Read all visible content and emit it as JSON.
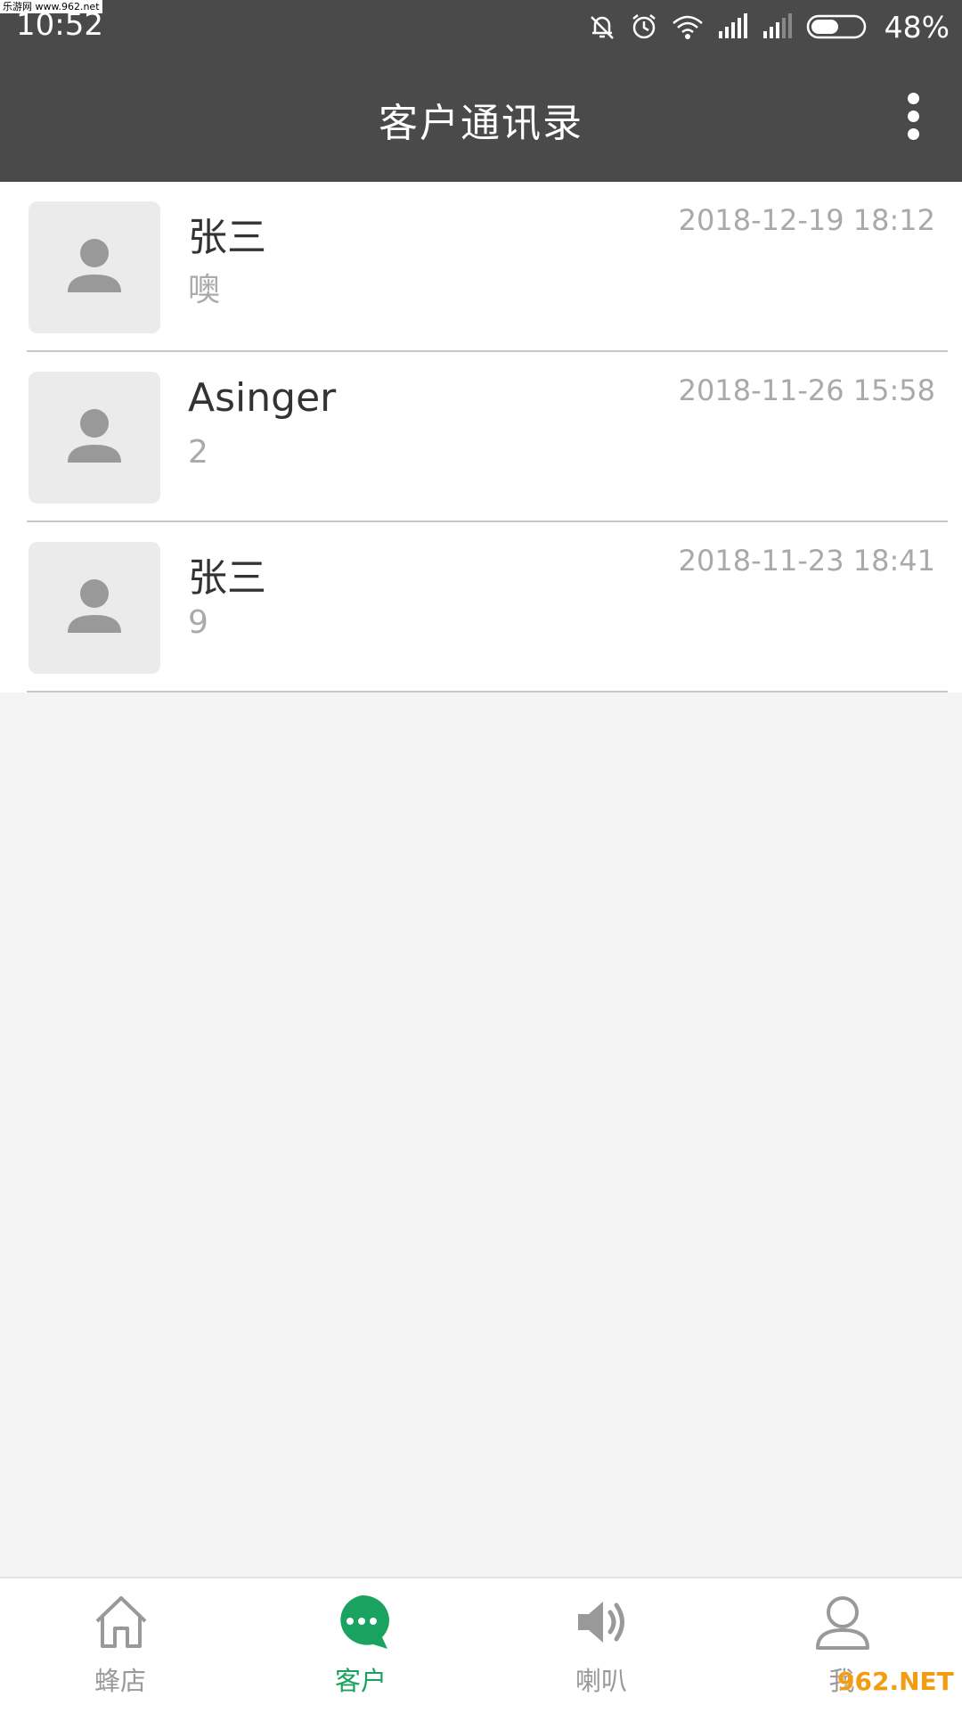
{
  "status_bar": {
    "time": "10:52",
    "watermark": "乐游网 www.962.net",
    "battery_percent": "48%"
  },
  "header": {
    "title": "客户通讯录",
    "menu_icon": "more-vertical-icon"
  },
  "contacts": [
    {
      "name": "张三",
      "last_message": "噢",
      "timestamp": "2018-12-19 18:12"
    },
    {
      "name": "Asinger",
      "last_message": "2",
      "timestamp": "2018-11-26 15:58"
    },
    {
      "name": "张三",
      "last_message": "9",
      "timestamp": "2018-11-23 18:41"
    }
  ],
  "bottom_nav": {
    "items": [
      {
        "label": "蜂店",
        "icon": "home-icon",
        "active": false
      },
      {
        "label": "客户",
        "icon": "chat-bubble-icon",
        "active": true
      },
      {
        "label": "喇叭",
        "icon": "speaker-icon",
        "active": false
      },
      {
        "label": "我",
        "icon": "user-icon",
        "active": false
      }
    ]
  },
  "colors": {
    "header_bg": "#4a4a4a",
    "accent": "#1aa260",
    "inactive_icon": "#999999"
  },
  "overlay_logo": "962.NET"
}
